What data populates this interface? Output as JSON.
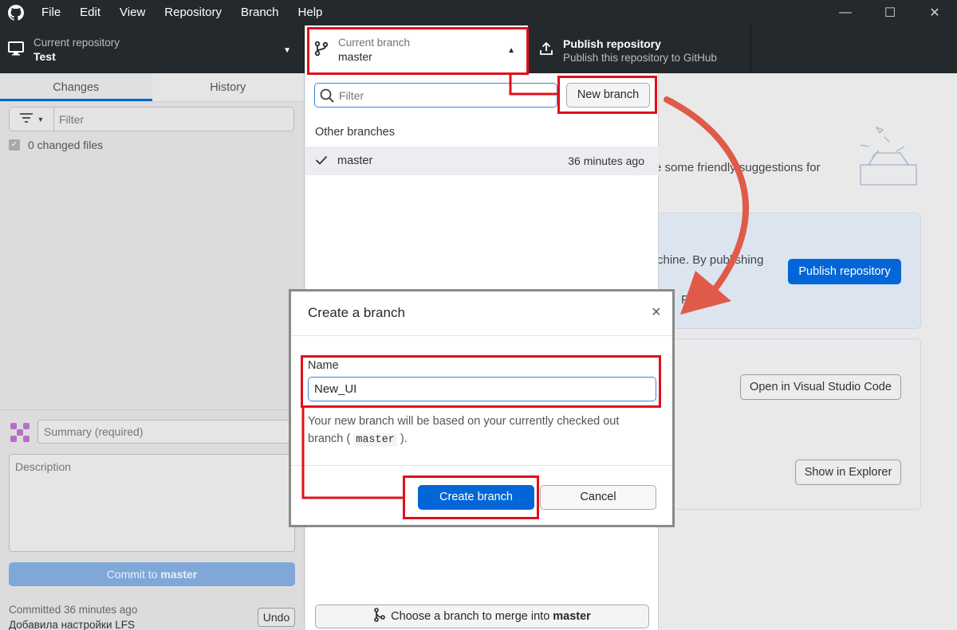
{
  "menu": [
    "File",
    "Edit",
    "View",
    "Repository",
    "Branch",
    "Help"
  ],
  "window_controls": {
    "minimize": "—",
    "maximize": "☐",
    "close": "✕"
  },
  "toolbar": {
    "repo_label": "Current repository",
    "repo_value": "Test",
    "branch_label": "Current branch",
    "branch_value": "master",
    "publish_title": "Publish repository",
    "publish_sub": "Publish this repository to GitHub"
  },
  "sidebar": {
    "tabs": [
      "Changes",
      "History"
    ],
    "filter_placeholder": "Filter",
    "changed_files": "0 changed files",
    "summary_placeholder": "Summary (required)",
    "description_placeholder": "Description",
    "commit_prefix": "Commit to ",
    "commit_branch": "master",
    "last_commit": "Committed 36 minutes ago",
    "last_message": "Добавила настройки LFS",
    "undo": "Undo"
  },
  "main": {
    "suggest_text": "e some friendly suggestions for",
    "card1_text": "chine. By publishing",
    "card1_text2": "P",
    "publish_button": "Publish repository",
    "vscode_button": "Open in Visual Studio Code",
    "explorer_button": "Show in Explorer"
  },
  "branch_panel": {
    "filter_placeholder": "Filter",
    "new_branch": "New branch",
    "other_branches": "Other branches",
    "branches": [
      {
        "name": "master",
        "time": "36 minutes ago",
        "checked": true
      }
    ],
    "merge_prefix": "Choose a branch to merge into ",
    "merge_branch": "master"
  },
  "dialog": {
    "title": "Create a branch",
    "close": "×",
    "name_label": "Name",
    "name_value": "New_UI",
    "desc_before": "Your new branch will be based on your currently checked out branch (",
    "desc_code": "master",
    "desc_after": ").",
    "create": "Create branch",
    "cancel": "Cancel"
  },
  "colors": {
    "accent": "#0366d6",
    "annotation_red": "#e0101a",
    "arrow": "#e05a4a",
    "titlebar": "#24292e"
  },
  "icons": [
    "github-logo-icon",
    "computer-icon",
    "branch-icon",
    "upload-icon",
    "filter-icon",
    "search-icon",
    "check-icon",
    "close-icon",
    "merge-icon",
    "caret-down-icon",
    "caret-up-icon"
  ]
}
